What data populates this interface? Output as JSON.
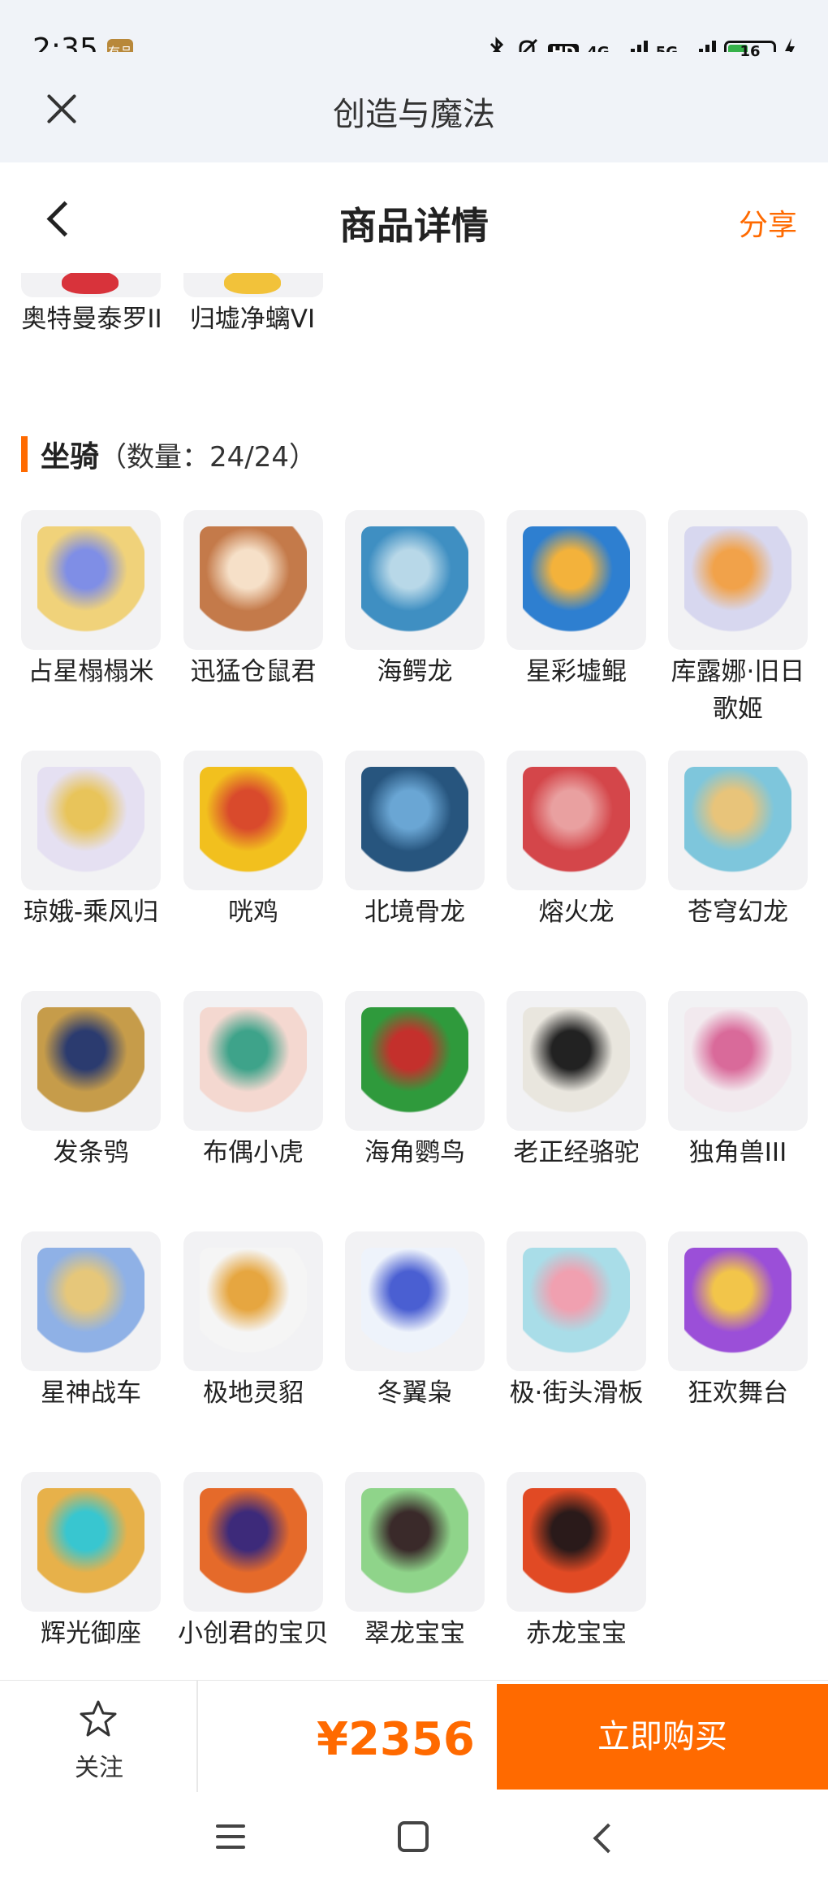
{
  "status": {
    "time": "2:35",
    "app_badge": "有品",
    "network_hd": "HD",
    "network_1": "4G",
    "network_2": "5G",
    "battery": "16"
  },
  "app_bar": {
    "title": "创造与魔法"
  },
  "header": {
    "title": "商品详情",
    "share": "分享"
  },
  "previous_items": [
    {
      "name": "奥特曼泰罗II",
      "color": "#d8333b"
    },
    {
      "name": "归墟净螭VI",
      "color": "#f2c23a"
    }
  ],
  "section": {
    "title": "坐骑",
    "count": "（数量：24/24）"
  },
  "mounts": [
    {
      "name": "占星榻榻米",
      "icon": "crystal-egg-icon",
      "c1": "#f0d27a",
      "c2": "#7f8ee6"
    },
    {
      "name": "迅猛仓鼠君",
      "icon": "hamster-icon",
      "c1": "#c47a4a",
      "c2": "#f6e0c8"
    },
    {
      "name": "海鳄龙",
      "icon": "sea-dragon-icon",
      "c1": "#3f8fc2",
      "c2": "#b8d8e8"
    },
    {
      "name": "星彩墟鲲",
      "icon": "whale-icon",
      "c1": "#2e7fd0",
      "c2": "#f3b23b"
    },
    {
      "name": "库露娜·旧日歌姬",
      "icon": "songstress-icon",
      "c1": "#d7d7ef",
      "c2": "#f1a24a"
    },
    {
      "name": "琼娥-乘风归",
      "icon": "fairy-icon",
      "c1": "#e5e0f2",
      "c2": "#e8c45a"
    },
    {
      "name": "咣鸡",
      "icon": "chicken-icon",
      "c1": "#f2c01e",
      "c2": "#d94a2c"
    },
    {
      "name": "北境骨龙",
      "icon": "bone-dragon-icon",
      "c1": "#27557e",
      "c2": "#6aa6d4"
    },
    {
      "name": "熔火龙",
      "icon": "lava-dragon-icon",
      "c1": "#d4464a",
      "c2": "#e9a0a0"
    },
    {
      "name": "苍穹幻龙",
      "icon": "sky-dragon-icon",
      "c1": "#7ec6dc",
      "c2": "#e8c47a"
    },
    {
      "name": "发条鸮",
      "icon": "owl-icon",
      "c1": "#c69c4a",
      "c2": "#2b3b6f"
    },
    {
      "name": "布偶小虎",
      "icon": "tiger-doll-icon",
      "c1": "#f4d8d0",
      "c2": "#3ea38a"
    },
    {
      "name": "海角鹦鸟",
      "icon": "parrot-icon",
      "c1": "#2f9a3c",
      "c2": "#c4302c"
    },
    {
      "name": "老正经骆驼",
      "icon": "camel-icon",
      "c1": "#e9e6de",
      "c2": "#222222"
    },
    {
      "name": "独角兽III",
      "icon": "unicorn-icon",
      "c1": "#f2e9ee",
      "c2": "#d96a9a"
    },
    {
      "name": "星神战车",
      "icon": "chariot-icon",
      "c1": "#8fb1e6",
      "c2": "#e6c77a"
    },
    {
      "name": "极地灵貂",
      "icon": "polar-mink-icon",
      "c1": "#f5f5f5",
      "c2": "#e6a640"
    },
    {
      "name": "冬翼枭",
      "icon": "winter-owl-icon",
      "c1": "#eef3fb",
      "c2": "#4a5fd2"
    },
    {
      "name": "极·街头滑板",
      "icon": "skateboard-icon",
      "c1": "#a9dde8",
      "c2": "#f0a0b0"
    },
    {
      "name": "狂欢舞台",
      "icon": "stage-icon",
      "c1": "#9b4fd8",
      "c2": "#f2c54a"
    },
    {
      "name": "辉光御座",
      "icon": "throne-icon",
      "c1": "#e7b14a",
      "c2": "#38c6d0"
    },
    {
      "name": "小创君的宝贝",
      "icon": "phoenix-icon",
      "c1": "#e56a2a",
      "c2": "#3d2a7a"
    },
    {
      "name": "翠龙宝宝",
      "icon": "green-dragon-icon",
      "c1": "#8fd48a",
      "c2": "#3a2a2a"
    },
    {
      "name": "赤龙宝宝",
      "icon": "red-dragon-icon",
      "c1": "#e14a24",
      "c2": "#2a1a1a"
    }
  ],
  "bottom": {
    "follow": "关注",
    "price": "¥2356",
    "buy": "立即购买"
  },
  "colors": {
    "accent": "#ff6a00",
    "card_bg": "#f2f2f4"
  }
}
